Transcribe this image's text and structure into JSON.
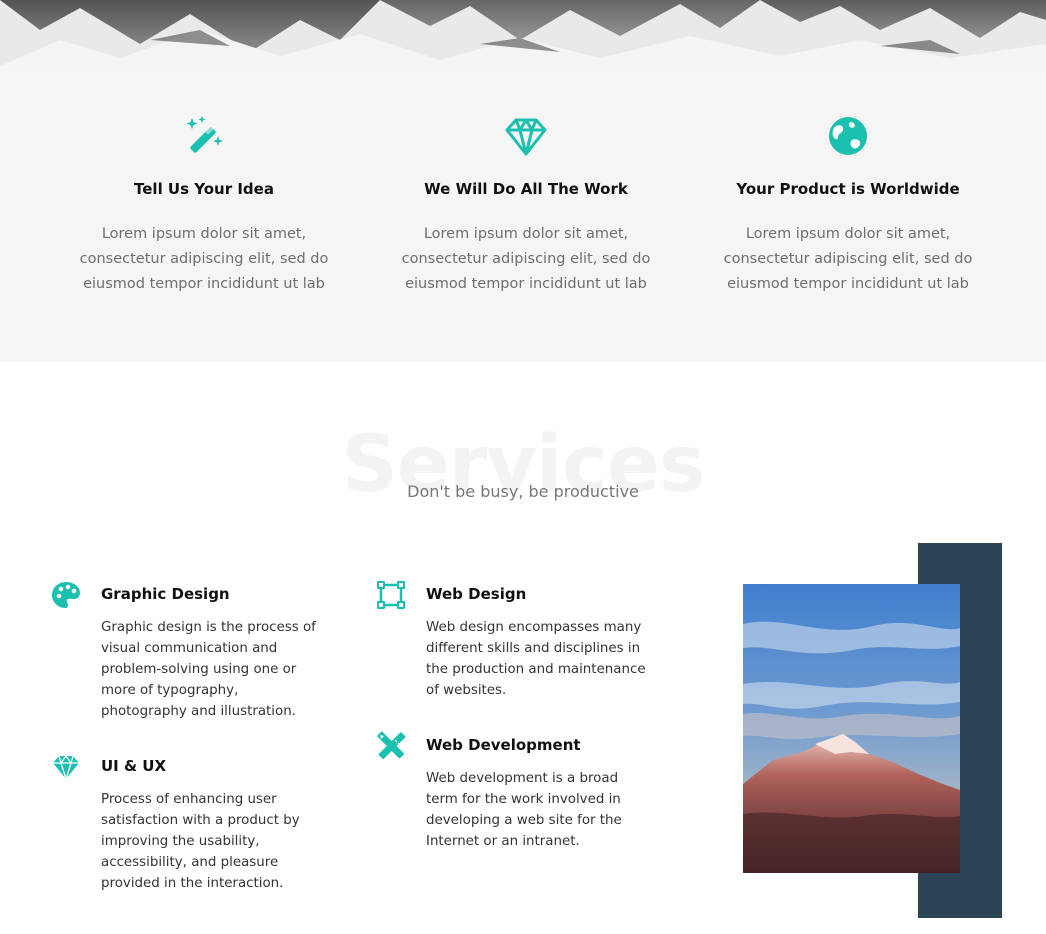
{
  "features": [
    {
      "icon": "magic-wand-icon",
      "title": "Tell Us Your Idea",
      "text": "Lorem ipsum dolor sit amet, consectetur adipiscing elit, sed do eiusmod tempor incididunt ut lab"
    },
    {
      "icon": "diamond-icon",
      "title": "We Will Do All The Work",
      "text": "Lorem ipsum dolor sit amet, consectetur adipiscing elit, sed do eiusmod tempor incididunt ut lab"
    },
    {
      "icon": "globe-icon",
      "title": "Your Product is Worldwide",
      "text": "Lorem ipsum dolor sit amet, consectetur adipiscing elit, sed do eiusmod tempor incididunt ut lab"
    }
  ],
  "services": {
    "title": "Services",
    "subtitle": "Don't be busy, be productive",
    "items": [
      {
        "icon": "palette-icon",
        "title": "Graphic Design",
        "text": "Graphic design is the process of visual communication and problem-solving using one or more of typography, photography and illustration."
      },
      {
        "icon": "diamond-icon",
        "title": "UI & UX",
        "text": "Process of enhancing user satisfaction with a product by improving the usability, accessibility, and pleasure provided in the interaction."
      },
      {
        "icon": "vector-square-icon",
        "title": "Web Design",
        "text": "Web design encompasses many different skills and disciplines in the production and maintenance of websites."
      },
      {
        "icon": "pencil-ruler-icon",
        "title": "Web Development",
        "text": "Web development is a broad term for the work involved in developing a web site for the Internet or an intranet."
      }
    ]
  },
  "colors": {
    "accent": "#1cc0b0",
    "dark_panel": "#2b4555",
    "band": "#f5f5f5"
  }
}
